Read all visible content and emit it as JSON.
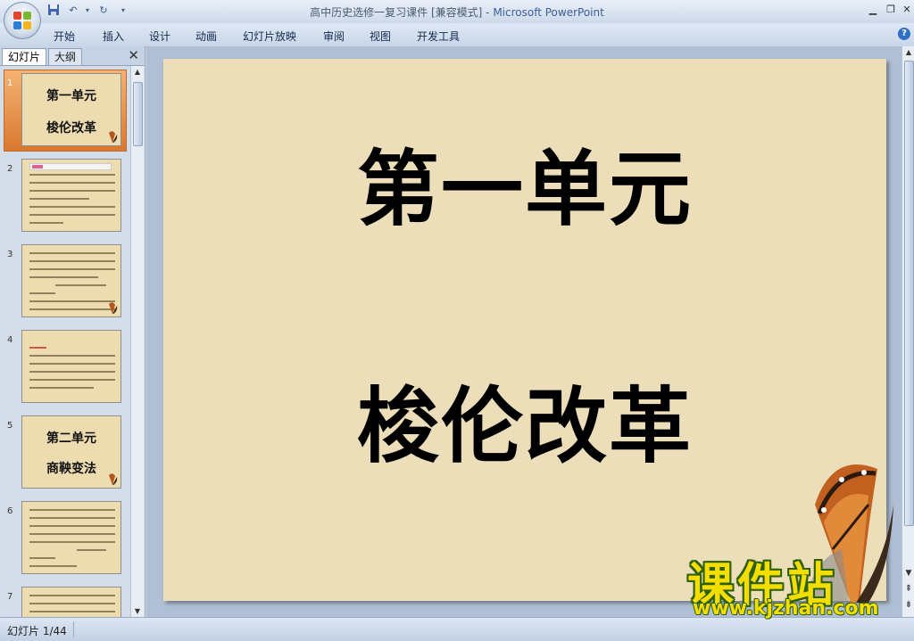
{
  "window": {
    "title_doc": "高中历史选修一复习课件 [兼容模式]",
    "title_sep": " - ",
    "title_app": "Microsoft PowerPoint"
  },
  "ribbon": {
    "tabs": [
      "开始",
      "插入",
      "设计",
      "动画",
      "幻灯片放映",
      "审阅",
      "视图",
      "开发工具"
    ]
  },
  "left_pane": {
    "tab_slides": "幻灯片",
    "tab_outline": "大纲",
    "thumbnails": [
      {
        "num": "1",
        "line1": "第一单元",
        "line2": "梭伦改革",
        "selected": true
      },
      {
        "num": "2"
      },
      {
        "num": "3"
      },
      {
        "num": "4"
      },
      {
        "num": "5",
        "line1": "第二单元",
        "line2": "商鞅变法"
      },
      {
        "num": "6"
      },
      {
        "num": "7"
      }
    ]
  },
  "slide": {
    "line1": "第一单元",
    "line2": "梭伦改革"
  },
  "status": {
    "slide_indicator": "幻灯片 1/44"
  },
  "watermark": {
    "text": "课件站",
    "url": "www.kjzhan.com"
  },
  "colors": {
    "slide_bg": "#ecdeb8",
    "selected_thumb": "#e08a3c",
    "watermark_yellow": "#f4dd00"
  }
}
